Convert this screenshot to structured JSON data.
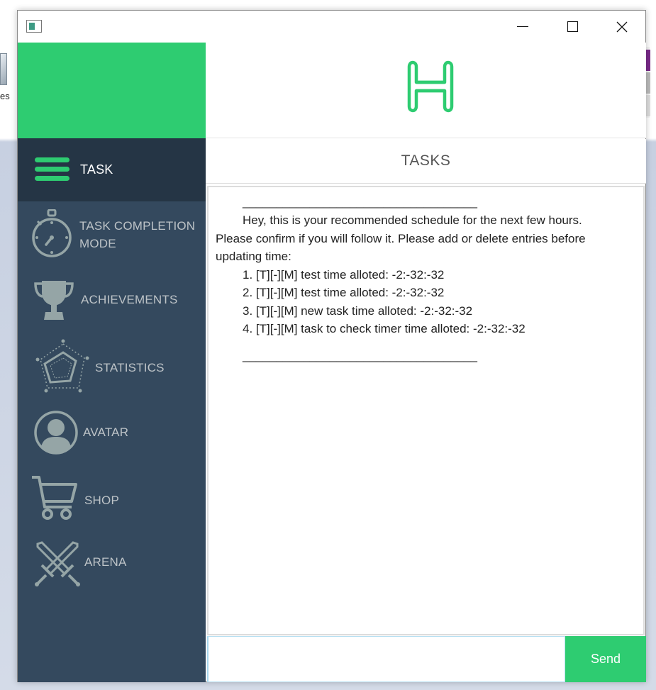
{
  "window": {
    "background_text": "es"
  },
  "sidebar": {
    "items": [
      {
        "id": "task",
        "label": "TASK",
        "icon": "hamburger-menu-icon",
        "active": true
      },
      {
        "id": "task-completion-mode",
        "label_line1": "TASK COMPLETION",
        "label_line2": "MODE",
        "icon": "stopwatch-icon"
      },
      {
        "id": "achievements",
        "label": "ACHIEVEMENTS",
        "icon": "trophy-icon"
      },
      {
        "id": "statistics",
        "label": "STATISTICS",
        "icon": "radar-chart-icon"
      },
      {
        "id": "avatar",
        "label": "AVATAR",
        "icon": "user-avatar-icon"
      },
      {
        "id": "shop",
        "label": "SHOP",
        "icon": "shopping-cart-icon"
      },
      {
        "id": "arena",
        "label": "ARENA",
        "icon": "crossed-swords-icon"
      }
    ]
  },
  "header": {
    "logo_icon": "h-logo-icon",
    "section_title": "TASKS"
  },
  "chat": {
    "separator": "___________________________________",
    "intro_line1": "Hey, this is your recommended schedule for the next few hours.",
    "intro_line2": "Please confirm if you will follow it. Please add or delete entries before",
    "intro_line3": "updating time:",
    "entries": [
      "1. [T][-][M] test time alloted: -2:-32:-32",
      "2. [T][-][M] test time alloted: -2:-32:-32",
      "3. [T][-][M] new task time alloted: -2:-32:-32",
      "4. [T][-][M] task to check timer time alloted: -2:-32:-32"
    ]
  },
  "input": {
    "value": "",
    "send_label": "Send"
  },
  "colors": {
    "accent": "#2ecc71",
    "sidebar": "#34495e",
    "sidebar_active": "#253545",
    "sidebar_text": "#bdc3c7"
  }
}
